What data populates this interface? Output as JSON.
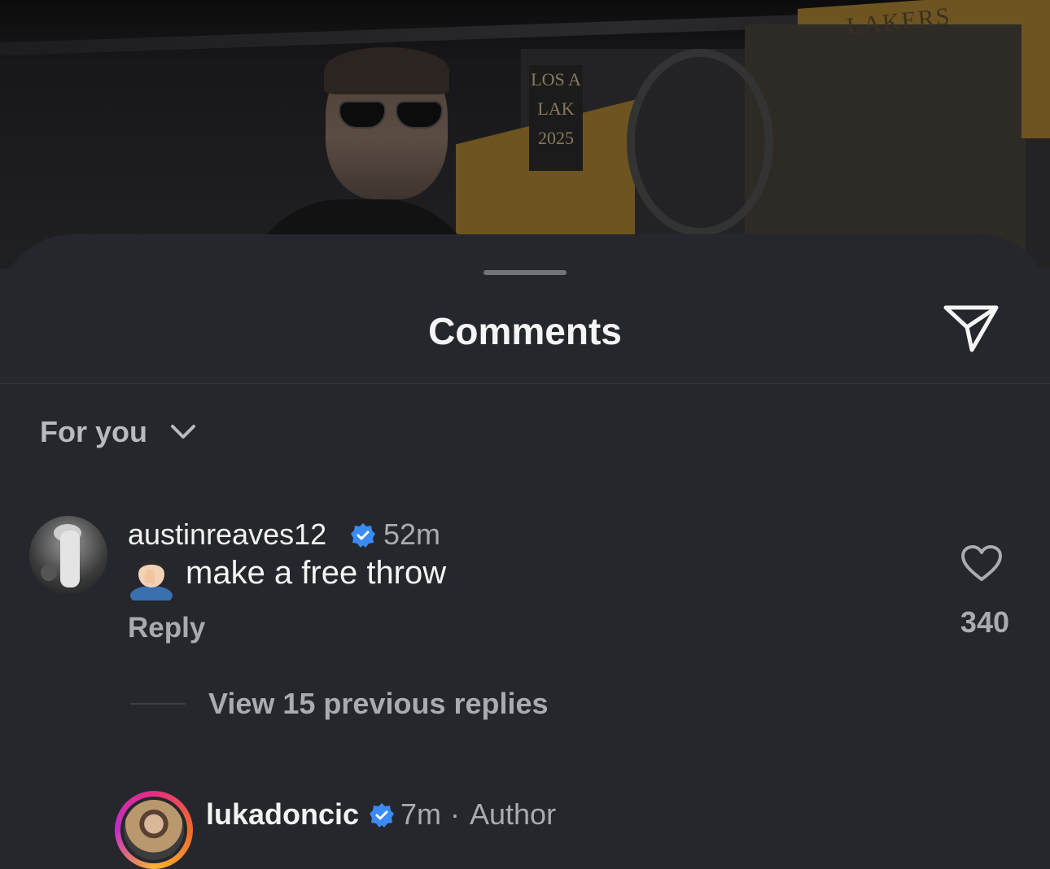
{
  "background_photo": {
    "sign_lines": [
      "LOS A",
      "LAK",
      "2025"
    ],
    "banner_text": "LAKERS"
  },
  "sheet": {
    "title": "Comments",
    "sort": {
      "label": "For you"
    }
  },
  "comment": {
    "username": "austinreaves12",
    "time": "52m",
    "emoji": "🤦🏻‍♂️",
    "text": "make a free throw",
    "reply_label": "Reply",
    "likes": "340"
  },
  "view_replies": "View 15 previous replies",
  "reply_comment": {
    "username": "lukadoncic",
    "time": "7m",
    "separator": "·",
    "author_tag": "Author"
  },
  "colors": {
    "background": "#25272c",
    "verified": "#3b8bf5",
    "secondary_text": "#a9abaf"
  },
  "icons": {
    "share": "send-icon",
    "sort": "chevron-down-icon",
    "like": "heart-icon",
    "verified": "verified-badge-icon"
  }
}
